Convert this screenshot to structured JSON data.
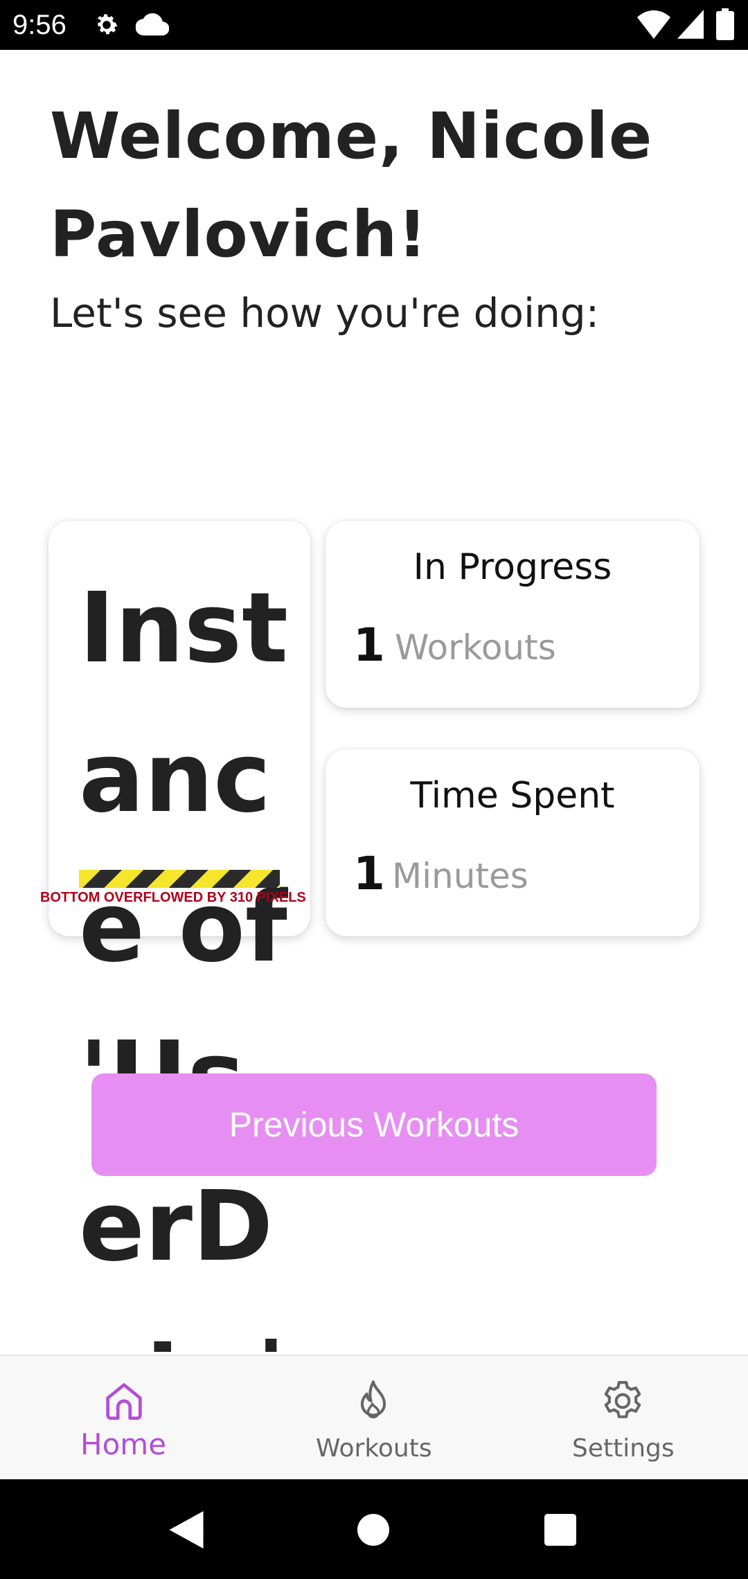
{
  "status_bar": {
    "time": "9:56",
    "icons": [
      "gear-icon",
      "cloud-icon",
      "wifi-icon",
      "cell-signal-icon",
      "battery-icon"
    ]
  },
  "header": {
    "welcome": "Welcome, Nicole Pavlovich!",
    "subtitle": "Let's see how you're doing:"
  },
  "cards": {
    "left_overflow_text": "Instance of 'UserData'",
    "overflow_error": "BOTTOM OVERFLOWED BY 310 PIXELS",
    "in_progress": {
      "title": "In Progress",
      "value": "1",
      "unit": "Workouts"
    },
    "time_spent": {
      "title": "Time Spent",
      "value": "1",
      "unit": "Minutes"
    }
  },
  "buttons": {
    "previous_workouts": "Previous Workouts"
  },
  "bottom_nav": {
    "items": [
      {
        "label": "Home",
        "icon": "home-icon",
        "active": true
      },
      {
        "label": "Workouts",
        "icon": "flame-icon",
        "active": false
      },
      {
        "label": "Settings",
        "icon": "settings-gear-icon",
        "active": false
      }
    ]
  },
  "colors": {
    "accent": "#b44cd6",
    "button": "#e68ef2",
    "overflow_error": "#b0001a",
    "stripe_yellow": "#f5e52b"
  }
}
